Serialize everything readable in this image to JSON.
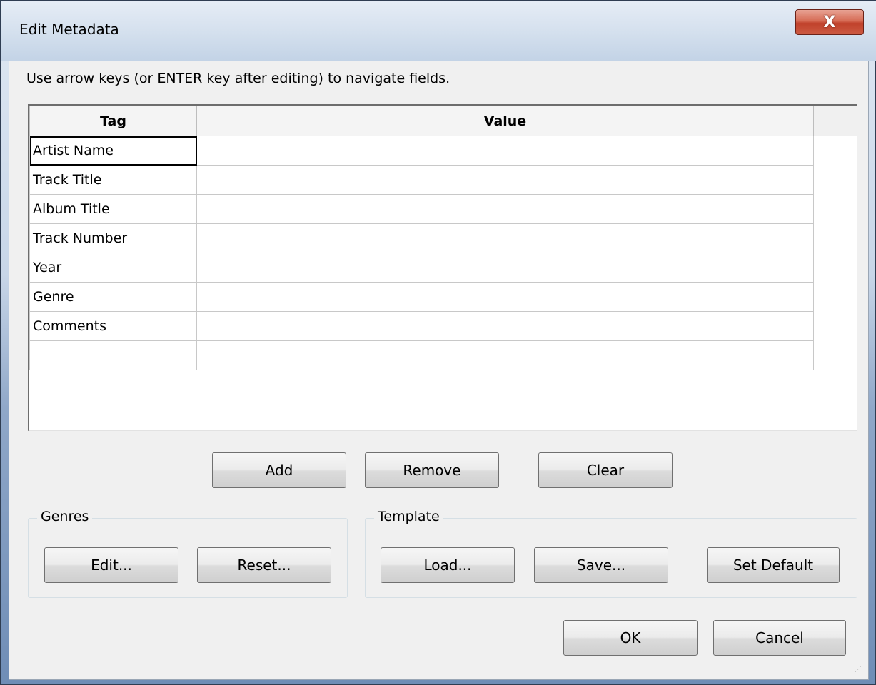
{
  "window": {
    "title": "Edit Metadata",
    "close_glyph": "X"
  },
  "hint": "Use arrow keys (or ENTER key after editing) to navigate fields.",
  "table": {
    "columns": [
      "Tag",
      "Value"
    ],
    "rows": [
      {
        "tag": "Artist Name",
        "value": ""
      },
      {
        "tag": "Track Title",
        "value": ""
      },
      {
        "tag": "Album Title",
        "value": ""
      },
      {
        "tag": "Track Number",
        "value": ""
      },
      {
        "tag": "Year",
        "value": ""
      },
      {
        "tag": "Genre",
        "value": ""
      },
      {
        "tag": "Comments",
        "value": ""
      },
      {
        "tag": "",
        "value": ""
      }
    ]
  },
  "actions": {
    "add": "Add",
    "remove": "Remove",
    "clear": "Clear"
  },
  "genres": {
    "label": "Genres",
    "edit": "Edit...",
    "reset": "Reset..."
  },
  "template": {
    "label": "Template",
    "load": "Load...",
    "save": "Save...",
    "set_default": "Set Default"
  },
  "footer": {
    "ok": "OK",
    "cancel": "Cancel"
  },
  "colors": {
    "close_button": "#c0412b",
    "dialog_background": "#f0f0f0"
  }
}
